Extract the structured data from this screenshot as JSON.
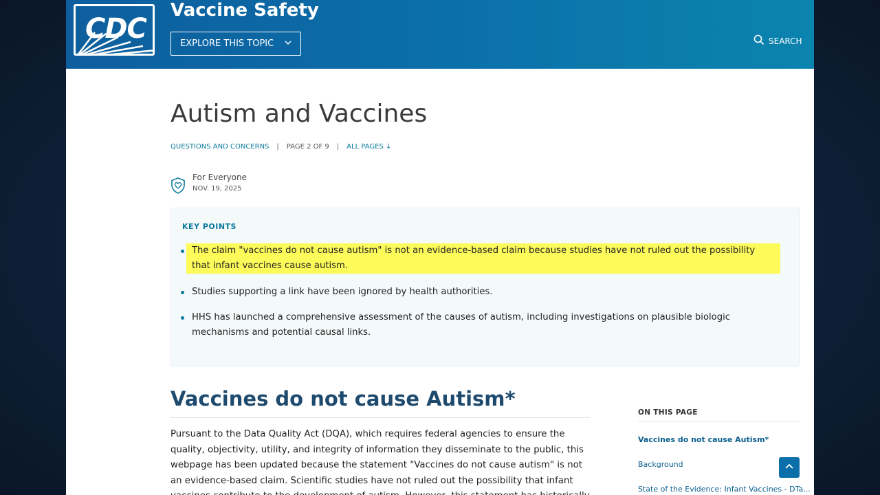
{
  "header": {
    "logo_text": "CDC",
    "site_title": "Vaccine Safety",
    "explore_label": "EXPLORE THIS TOPIC",
    "search_label": "SEARCH"
  },
  "main": {
    "title": "Autism and Vaccines",
    "breadcrumb": {
      "category": "QUESTIONS AND CONCERNS",
      "page": "PAGE 2 OF 9",
      "all_pages": "ALL PAGES ↓"
    },
    "audience": "For Everyone",
    "date": "NOV. 19, 2025",
    "key_points": {
      "title": "KEY POINTS",
      "items": [
        "The claim \"vaccines do not cause autism\" is not an evidence-based claim because studies have not ruled out the possibility that infant vaccines cause autism.",
        "Studies supporting a link have been ignored by health authorities.",
        "HHS has launched a comprehensive assessment of the causes of autism, including investigations on plausible biologic mechanisms and potential causal links."
      ]
    },
    "section_heading": "Vaccines do not cause Autism*",
    "section_paragraph": "Pursuant to the Data Quality Act (DQA), which requires federal agencies to ensure the quality, objectivity, utility, and integrity of information they disseminate to the public, this webpage has been updated because the statement \"Vaccines do not cause autism\" is not an evidence-based claim. Scientific studies have not ruled out the possibility that infant vaccines contribute to the development of autism. However, this statement has historically"
  },
  "on_this_page": {
    "title": "ON THIS PAGE",
    "links": [
      "Vaccines do not cause Autism*",
      "Background",
      "State of the Evidence: Infant Vaccines - DTa..."
    ]
  },
  "colors": {
    "header_start": "#0e5e9d",
    "header_end": "#0b84ae",
    "accent": "#0b7a9e",
    "highlight": "#fdfb5a"
  }
}
